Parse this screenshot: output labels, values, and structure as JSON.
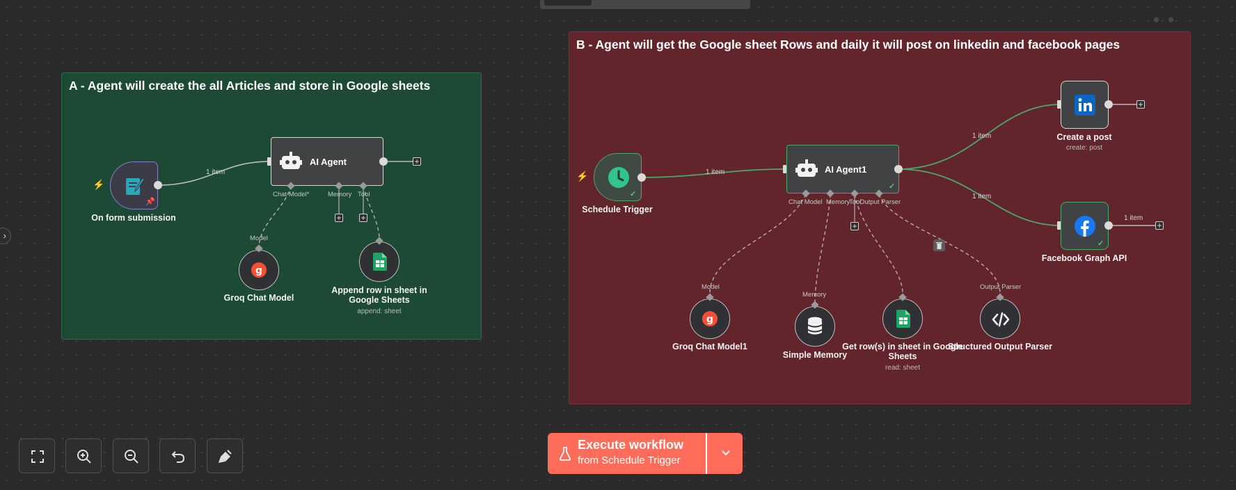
{
  "sticky_notes": {
    "a_title": "A - Agent will create the all Articles and store in Google sheets",
    "b_title": "B - Agent will get the Google sheet Rows and daily it will post on linkedin and facebook pages"
  },
  "nodes": {
    "form_trigger": {
      "label": "On form submission",
      "icon": "form-pencil-icon"
    },
    "ai_agent": {
      "label": "AI Agent",
      "icon": "robot-icon"
    },
    "groq_model": {
      "label": "Groq Chat Model",
      "icon": "groq-icon"
    },
    "append_row": {
      "label": "Append row in sheet in Google Sheets",
      "subtitle": "append: sheet",
      "icon": "google-sheets-icon"
    },
    "schedule_trigger": {
      "label": "Schedule Trigger",
      "icon": "clock-icon"
    },
    "ai_agent1": {
      "label": "AI Agent1",
      "icon": "robot-icon"
    },
    "groq_model1": {
      "label": "Groq Chat Model1",
      "icon": "groq-icon"
    },
    "simple_memory": {
      "label": "Simple Memory",
      "icon": "database-icon"
    },
    "get_rows": {
      "label": "Get row(s) in sheet in Google Sheets",
      "subtitle": "read: sheet",
      "icon": "google-sheets-icon"
    },
    "output_parser": {
      "label": "Structured Output Parser",
      "icon": "code-icon"
    },
    "linkedin": {
      "label": "Create a post",
      "subtitle": "create: post",
      "icon": "linkedin-icon"
    },
    "facebook": {
      "label": "Facebook Graph API",
      "icon": "facebook-icon"
    }
  },
  "ports": {
    "chat_model_required": "Chat Model*",
    "memory": "Memory",
    "tool": "Tool",
    "model": "Model",
    "chat_model": "Chat Model",
    "tool_short": "Tool",
    "output_parser": "Output Parser"
  },
  "edge_labels": {
    "form_to_agent": "1 item",
    "schedule_to_agent1": "1 item",
    "agent1_to_linkedin": "1 item",
    "agent1_to_facebook": "1 item",
    "facebook_out": "1 item"
  },
  "toolbar": {
    "fit_view": "fit-view-icon",
    "zoom_in": "zoom-in-icon",
    "zoom_out": "zoom-out-icon",
    "undo": "undo-icon",
    "tidy_up": "broom-icon"
  },
  "execute": {
    "line1": "Execute workflow",
    "line2": "from Schedule Trigger",
    "icon": "flask-icon"
  },
  "colors": {
    "canvas": "#2b2b2b",
    "sticky_a": "#1d4a35",
    "sticky_b": "#63252c",
    "execute_button": "#ff6d5a",
    "success_edge": "#4aa86a",
    "linkedin": "#0a66c2",
    "facebook": "#1877f2",
    "sheets": "#1fa463",
    "groq": "#f55036"
  }
}
